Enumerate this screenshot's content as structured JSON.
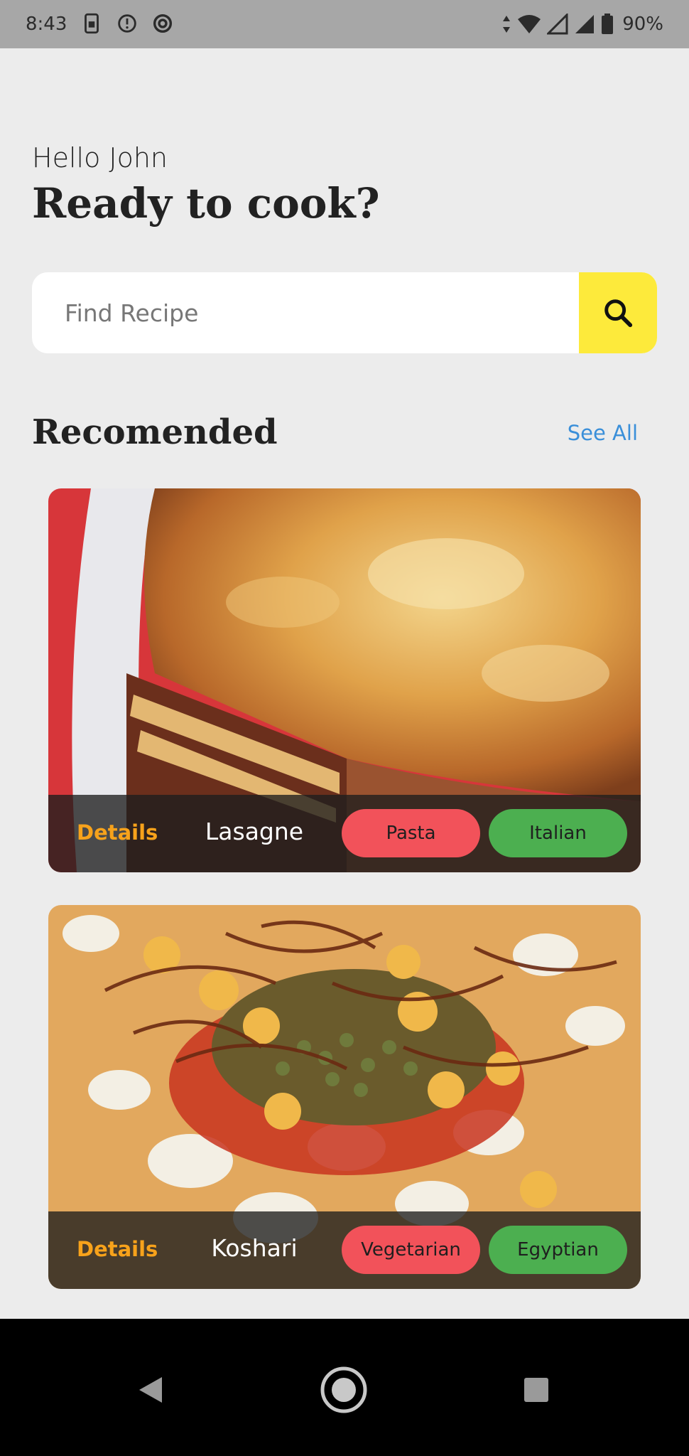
{
  "status_bar": {
    "time": "8:43",
    "battery": "90%",
    "icons": [
      "sim-card-icon",
      "data-saver-icon",
      "at-sign-icon",
      "data-arrows-icon",
      "wifi-icon",
      "signal-icon",
      "signal-icon",
      "battery-icon"
    ]
  },
  "header": {
    "greeting": "Hello John",
    "headline": "Ready to cook?"
  },
  "search": {
    "placeholder": "Find Recipe",
    "icon": "search-icon",
    "accent": "#fdea3b"
  },
  "section": {
    "title": "Recomended",
    "see_all": "See All"
  },
  "recipes": [
    {
      "details_label": "Details",
      "name": "Lasagne",
      "tags": [
        "Pasta",
        "Italian"
      ]
    },
    {
      "details_label": "Details",
      "name": "Koshari",
      "tags": [
        "Vegetarian",
        "Egyptian"
      ]
    }
  ],
  "colors": {
    "details": "#f7a21b",
    "tag_red": "#f2525a",
    "tag_green": "#4caf50",
    "link": "#3a8fd9"
  },
  "nav": {
    "icons": [
      "back-icon",
      "home-icon",
      "recents-icon"
    ]
  }
}
